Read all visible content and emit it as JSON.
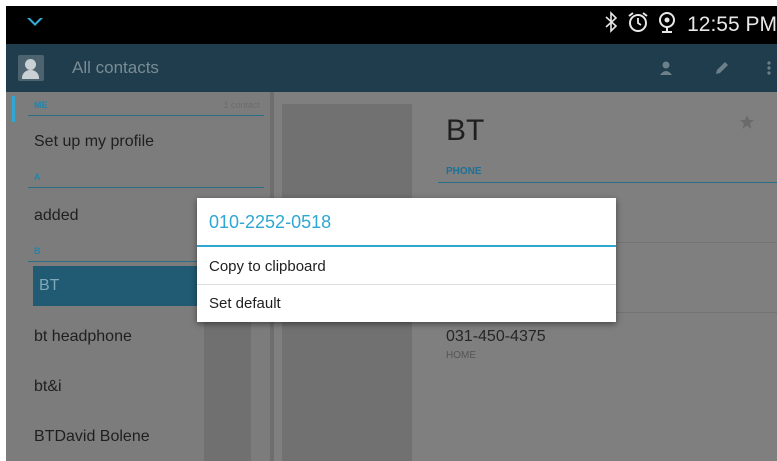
{
  "status_bar": {
    "time": "12:55 PM",
    "icons": [
      "bluetooth-icon",
      "alarm-icon",
      "gps-icon"
    ]
  },
  "action_bar": {
    "title": "All contacts",
    "icons": [
      "person-add-icon",
      "edit-icon",
      "overflow-menu-icon"
    ]
  },
  "contacts_list": {
    "sections": [
      {
        "title": "ME",
        "count": "1 contact"
      },
      {
        "title": "A"
      },
      {
        "title": "B"
      }
    ],
    "items": [
      {
        "label": "Set up my profile"
      },
      {
        "label": "added"
      },
      {
        "label": "BT",
        "selected": true
      },
      {
        "label": "bt headphone"
      },
      {
        "label": "bt&i"
      },
      {
        "label": "BTDavid Bolene"
      }
    ]
  },
  "detail": {
    "name": "BT",
    "phone_header": "PHONE",
    "numbers": [
      {
        "number": "031-450-4375",
        "type": "HOME"
      }
    ]
  },
  "dialog": {
    "title": "010-2252-0518",
    "options": [
      "Copy to clipboard",
      "Set default"
    ]
  },
  "colors": {
    "accent": "#2ea7d2",
    "action_bar": "#1f3d4c",
    "selected_row": "#205a73",
    "scrim_background": "#7f7f7f"
  }
}
